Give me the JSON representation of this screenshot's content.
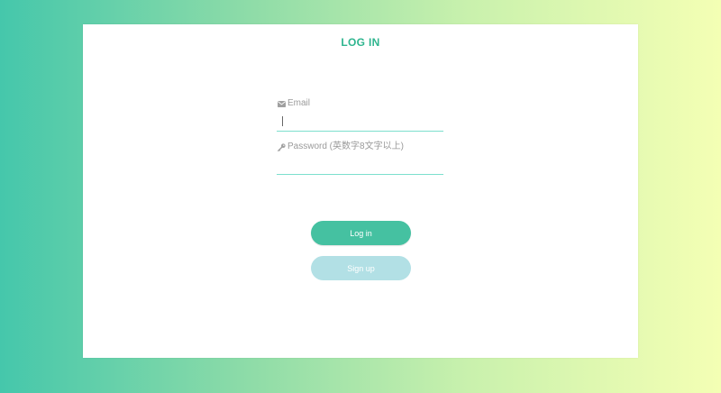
{
  "login_form": {
    "title": "LOG IN",
    "email": {
      "icon": "envelope-icon",
      "label": "Email",
      "value": ""
    },
    "password": {
      "icon": "key-icon",
      "label": "Password (英数字8文字以上)",
      "value": ""
    },
    "login_button_label": "Log in",
    "signup_button_label": "Sign up"
  },
  "colors": {
    "accent": "#2fb58f",
    "login_button": "#45c1a1",
    "signup_button": "#b2e0e5",
    "input_underline": "#7ddfcd",
    "gradient_start": "#45c7ab",
    "gradient_end": "#f4ffb4"
  }
}
